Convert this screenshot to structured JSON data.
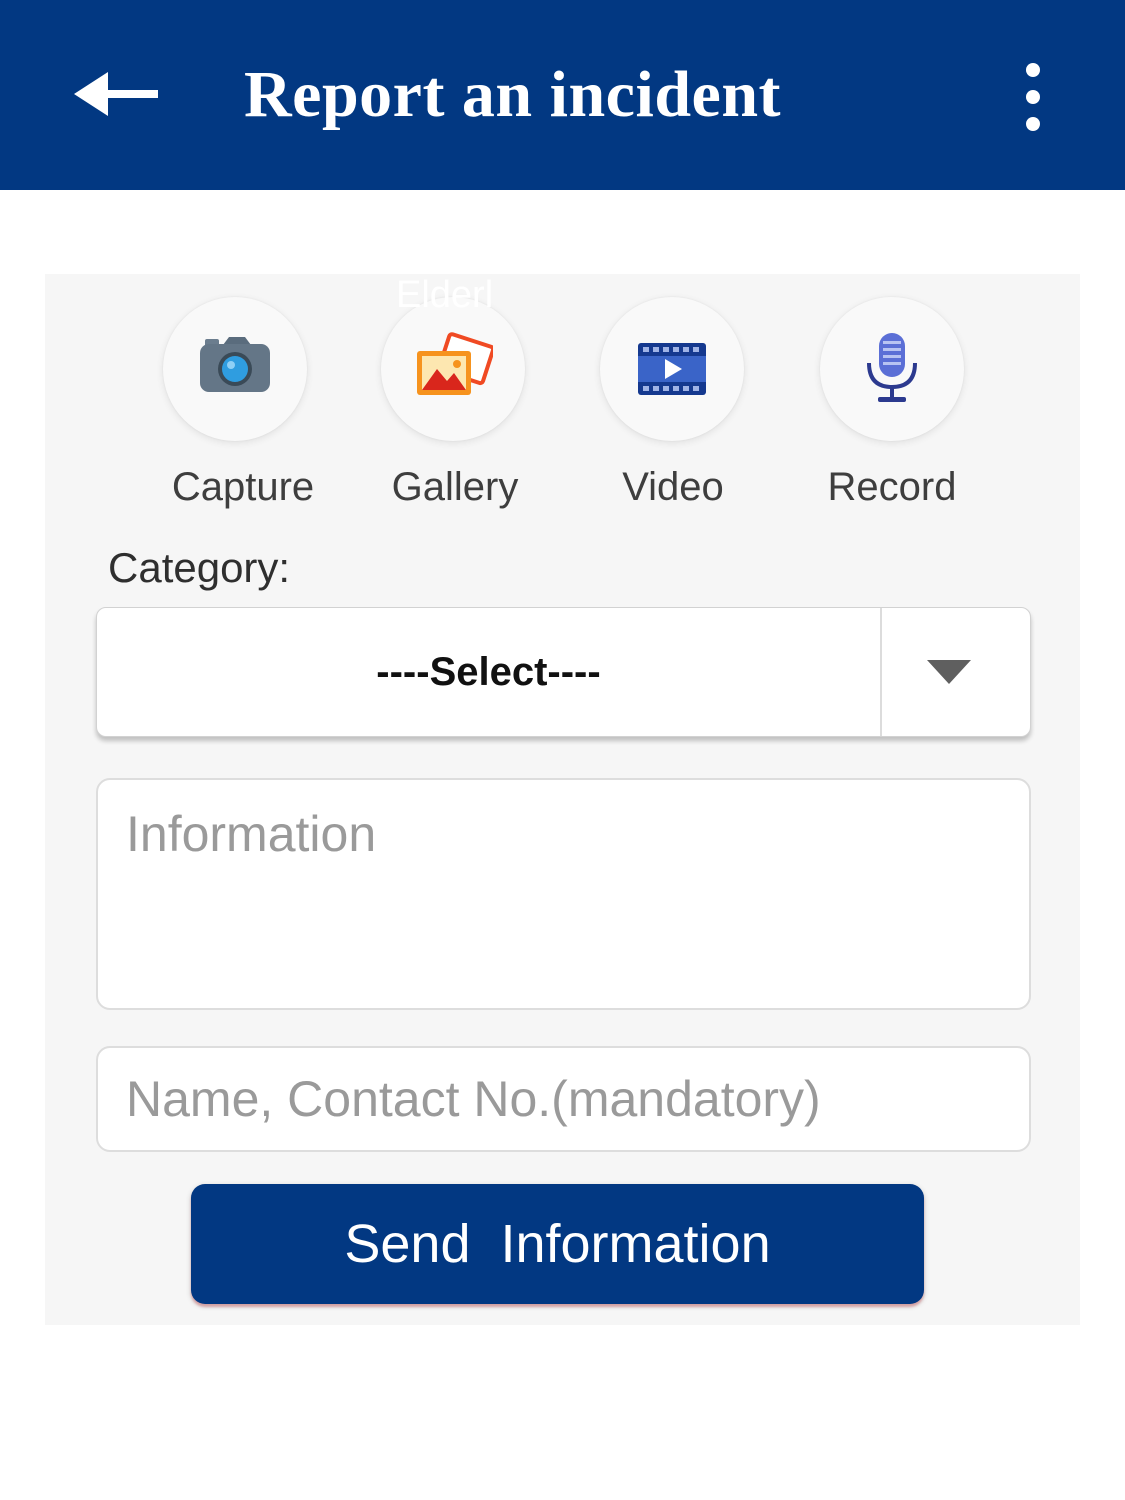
{
  "header": {
    "title": "Report an incident",
    "background_color": "#023882",
    "back_icon": "arrow-left-icon",
    "menu_icon": "more-vertical-icon"
  },
  "overlay_text": "Elderl",
  "media_actions": [
    {
      "label": "Capture",
      "icon": "camera-icon"
    },
    {
      "label": "Gallery",
      "icon": "gallery-icon"
    },
    {
      "label": "Video",
      "icon": "video-icon"
    },
    {
      "label": "Record",
      "icon": "microphone-icon"
    }
  ],
  "form": {
    "category_label": "Category:",
    "category_selected": "----Select----",
    "information_placeholder": "Information",
    "contact_placeholder": "Name, Contact No.(mandatory)",
    "submit_label": "Send  Information"
  },
  "colors": {
    "primary": "#023882",
    "panel_background": "#f6f6f6"
  }
}
